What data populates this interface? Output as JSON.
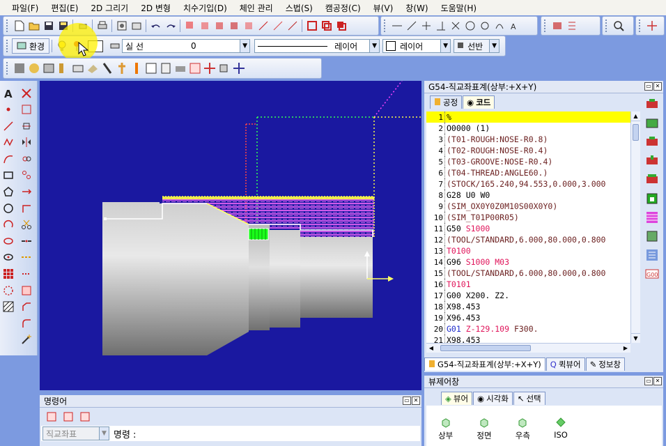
{
  "menu": [
    "파일(F)",
    "편집(E)",
    "2D 그리기",
    "2D 변형",
    "치수기입(D)",
    "체인 관리",
    "스법(S)",
    "캠공정(C)",
    "뷰(V)",
    "창(W)",
    "도움말(H)"
  ],
  "toolbar2": {
    "env_label": "환경",
    "linetype": "실 선",
    "lineweight": "0",
    "layer_left": "레이어",
    "layer_right": "레이어",
    "machine": "선반"
  },
  "gpanel": {
    "title": "G54-직교좌표계(상부:+X+Y)",
    "tab_process": "공정",
    "tab_code": "코드"
  },
  "code_lines": [
    {
      "n": "1",
      "parts": [
        {
          "t": "%",
          "c": "k"
        }
      ]
    },
    {
      "n": "2",
      "parts": [
        {
          "t": "O0000 (1)",
          "c": "k"
        }
      ]
    },
    {
      "n": "3",
      "parts": [
        {
          "t": "(T01-ROUGH:NOSE-R0.8)",
          "c": ""
        }
      ]
    },
    {
      "n": "4",
      "parts": [
        {
          "t": "(T02-ROUGH:NOSE-R0.4)",
          "c": ""
        }
      ]
    },
    {
      "n": "5",
      "parts": [
        {
          "t": "(T03-GROOVE:NOSE-R0.4)",
          "c": ""
        }
      ]
    },
    {
      "n": "6",
      "parts": [
        {
          "t": "(T04-THREAD:ANGLE60.)",
          "c": ""
        }
      ]
    },
    {
      "n": "7",
      "parts": [
        {
          "t": "(STOCK/165.240,94.553,0.000,3.000",
          "c": ""
        }
      ]
    },
    {
      "n": "8",
      "parts": [
        {
          "t": "G28 U0 W0",
          "c": "k"
        }
      ]
    },
    {
      "n": "9",
      "parts": [
        {
          "t": "(SIM_OX0Y0Z0M10S00X0Y0)",
          "c": ""
        }
      ]
    },
    {
      "n": "10",
      "parts": [
        {
          "t": "(SIM_T01P00R05)",
          "c": ""
        }
      ]
    },
    {
      "n": "11",
      "parts": [
        {
          "t": "G50 ",
          "c": "k"
        },
        {
          "t": "S1000",
          "c": "r"
        }
      ]
    },
    {
      "n": "12",
      "parts": [
        {
          "t": "(TOOL/STANDARD,6.000,80.000,0.800",
          "c": ""
        }
      ]
    },
    {
      "n": "13",
      "parts": [
        {
          "t": "T0100",
          "c": "r"
        }
      ]
    },
    {
      "n": "14",
      "parts": [
        {
          "t": "G96 ",
          "c": "k"
        },
        {
          "t": "S1000 M03",
          "c": "r"
        }
      ]
    },
    {
      "n": "15",
      "parts": [
        {
          "t": "(TOOL/STANDARD,6.000,80.000,0.800",
          "c": ""
        }
      ]
    },
    {
      "n": "16",
      "parts": [
        {
          "t": "T0101",
          "c": "r"
        }
      ]
    },
    {
      "n": "17",
      "parts": [
        {
          "t": "G00 X200. Z2.",
          "c": "k"
        }
      ]
    },
    {
      "n": "18",
      "parts": [
        {
          "t": "X98.453",
          "c": "k"
        }
      ]
    },
    {
      "n": "19",
      "parts": [
        {
          "t": "X96.453",
          "c": "k"
        }
      ]
    },
    {
      "n": "20",
      "parts": [
        {
          "t": "G01 ",
          "c": "b"
        },
        {
          "t": "Z-129.109 ",
          "c": "r"
        },
        {
          "t": "F300.",
          "c": ""
        }
      ]
    },
    {
      "n": "21",
      "parts": [
        {
          "t": "X98.453",
          "c": "k"
        }
      ]
    }
  ],
  "bottom_tabs": {
    "coord": "G54-직교좌표계(상부:+X+Y)",
    "quickview": "퀵뷰어",
    "info": "정보창"
  },
  "viewctrl": {
    "title": "뷰제어창",
    "tab_viewer": "뷰어",
    "tab_visual": "시각화",
    "tab_select": "선택",
    "views": [
      "상부",
      "정면",
      "우측",
      "ISO"
    ]
  },
  "command": {
    "title": "명령어",
    "coord_mode": "직교좌표",
    "prompt": "명령 :"
  },
  "colors": {
    "viewport_bg": "#1a18a0",
    "highlight": "#ffff00",
    "keyword_red": "#e0145a",
    "gcode_blue": "#1d2bc9",
    "comment": "#6b1f1f"
  }
}
